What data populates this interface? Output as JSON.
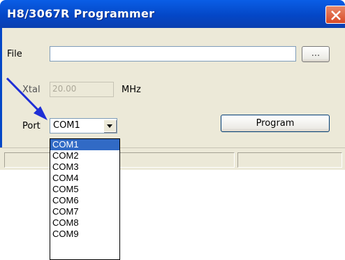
{
  "window": {
    "title": "H8/3067R Programmer",
    "close_label": "Close"
  },
  "form": {
    "file_label": "File",
    "file_value": "",
    "browse_label": "...",
    "xtal_label": "Xtal",
    "xtal_value": "20.00",
    "xtal_unit": "MHz",
    "port_label": "Port",
    "port_selected": "COM1",
    "program_label": "Program"
  },
  "port_options": [
    "COM1",
    "COM2",
    "COM3",
    "COM4",
    "COM5",
    "COM6",
    "COM7",
    "COM8",
    "COM9"
  ],
  "selected_option_index": 0,
  "colors": {
    "titlebar": "#0447c7",
    "selection": "#316ac5",
    "annotation_arrow": "#1f2fd6"
  }
}
